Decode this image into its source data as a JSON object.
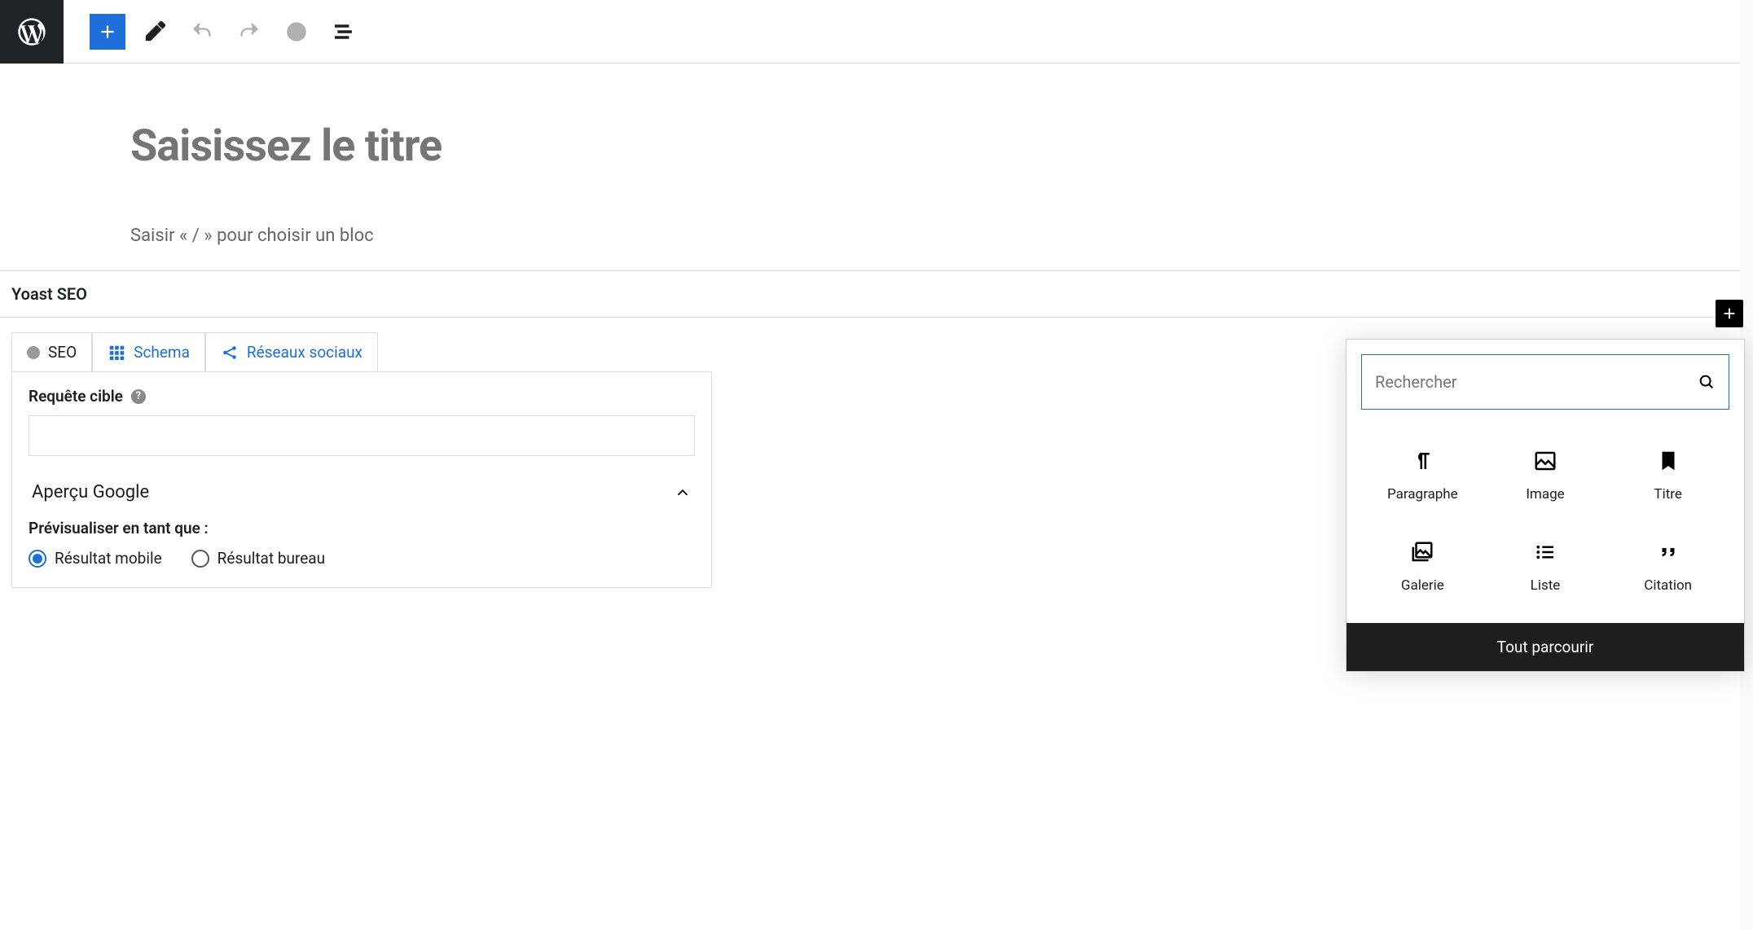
{
  "toolbar": {},
  "editor": {
    "title_placeholder": "Saisissez le titre",
    "block_hint": "Saisir « / » pour choisir un bloc"
  },
  "yoast": {
    "panel_title": "Yoast SEO",
    "tabs": {
      "seo": "SEO",
      "schema": "Schema",
      "social": "Réseaux sociaux"
    },
    "focus_keyword_label": "Requête cible",
    "google_preview_title": "Aperçu Google",
    "preview_as_label": "Prévisualiser en tant que :",
    "preview_mobile": "Résultat mobile",
    "preview_desktop": "Résultat bureau"
  },
  "inserter": {
    "search_placeholder": "Rechercher",
    "blocks": {
      "paragraph": "Paragraphe",
      "image": "Image",
      "heading": "Titre",
      "gallery": "Galerie",
      "list": "Liste",
      "quote": "Citation"
    },
    "browse_all": "Tout parcourir"
  }
}
